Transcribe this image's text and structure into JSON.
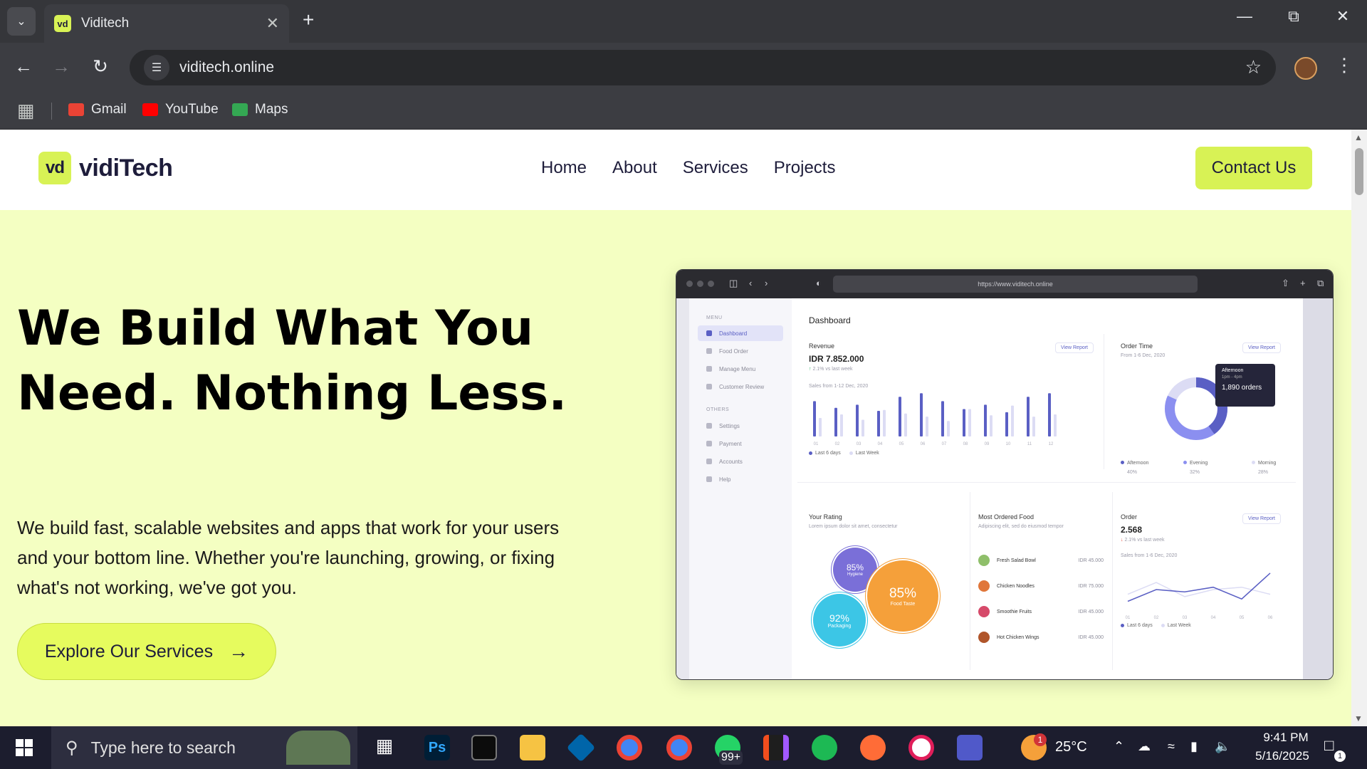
{
  "browser": {
    "tab_list_icon": "chevron-down-icon",
    "tab_title": "Viditech",
    "favicon_text": "vd",
    "url": "viditech.online",
    "bookmarks": [
      {
        "label": "Gmail",
        "color": "#ea4335"
      },
      {
        "label": "YouTube",
        "color": "#ff0000"
      },
      {
        "label": "Maps",
        "color": "#34a853"
      }
    ]
  },
  "site": {
    "logo_mark": "vd",
    "brand": "vidiTech",
    "nav": [
      "Home",
      "About",
      "Services",
      "Projects"
    ],
    "contact_label": "Contact Us",
    "accent": "#d8f255",
    "hero_bg": "#f4ffc2",
    "hero_title": "We Build What You Need. Nothing Less.",
    "hero_desc": "We build fast, scalable websites and apps that work for your users and your bottom line. Whether you're launching, growing, or fixing what's not working, we've got you.",
    "cta_label": "Explore Our Services"
  },
  "mockup": {
    "url": "https://www.viditech.online",
    "menu_heading": "MENU",
    "menu": [
      "Dashboard",
      "Food Order",
      "Manage Menu",
      "Customer Review"
    ],
    "others_heading": "OTHERS",
    "others": [
      "Settings",
      "Payment",
      "Accounts",
      "Help"
    ],
    "title": "Dashboard",
    "revenue": {
      "title": "Revenue",
      "value": "IDR 7.852.000",
      "delta": "2.1% vs last week",
      "subtitle": "Sales from 1-12 Dec, 2020",
      "view": "View Report",
      "legend": [
        "Last 6 days",
        "Last Week"
      ],
      "categories": [
        "01",
        "02",
        "03",
        "04",
        "05",
        "06",
        "07",
        "08",
        "09",
        "10",
        "11",
        "12"
      ],
      "last6": [
        0.8,
        0.65,
        0.72,
        0.58,
        0.9,
        0.98,
        0.8,
        0.62,
        0.72,
        0.55,
        0.9,
        0.98
      ],
      "lastweek": [
        0.42,
        0.5,
        0.38,
        0.6,
        0.52,
        0.45,
        0.35,
        0.62,
        0.48,
        0.7,
        0.45,
        0.5
      ]
    },
    "order_time": {
      "title": "Order Time",
      "subtitle": "From 1-6 Dec, 2020",
      "view": "View Report",
      "tooltip_label": "Afternoon",
      "tooltip_time": "1pm - 4pm",
      "tooltip_value": "1,890 orders",
      "legend": [
        {
          "label": "Afternoon",
          "pct": "40%",
          "value": 40,
          "color": "#5a5fc4"
        },
        {
          "label": "Evening",
          "pct": "32%",
          "value": 32,
          "color": "#8b8ff0"
        },
        {
          "label": "Morning",
          "pct": "28%",
          "value": 28,
          "color": "#dcdcf4"
        }
      ]
    },
    "rating": {
      "title": "Your Rating",
      "subtitle": "Lorem ipsum dolor sit amet, consectetur",
      "bubbles": [
        {
          "pct": "85%",
          "label": "Hygiene",
          "color": "#7a6fd8"
        },
        {
          "pct": "85%",
          "label": "Food Taste",
          "color": "#f5a03a"
        },
        {
          "pct": "92%",
          "label": "Packaging",
          "color": "#3cc6e6"
        }
      ]
    },
    "most_ordered": {
      "title": "Most Ordered Food",
      "subtitle": "Adipiscing elit, sed do eiusmod tempor",
      "items": [
        {
          "name": "Fresh Salad Bowl",
          "price": "IDR 45.000",
          "color": "#8fbf6a"
        },
        {
          "name": "Chicken Noodles",
          "price": "IDR 75.000",
          "color": "#e0763a"
        },
        {
          "name": "Smoothie Fruits",
          "price": "IDR 45.000",
          "color": "#d64a6a"
        },
        {
          "name": "Hot Chicken Wings",
          "price": "IDR 45.000",
          "color": "#b0552a"
        }
      ]
    },
    "order": {
      "title": "Order",
      "value": "2.568",
      "delta": "2.1% vs last week",
      "subtitle": "Sales from 1-6 Dec, 2020",
      "view": "View Report",
      "legend": [
        "Last 6 days",
        "Last Week"
      ],
      "categories": [
        "01",
        "02",
        "03",
        "04",
        "05",
        "06"
      ],
      "last6": [
        0.25,
        0.5,
        0.45,
        0.55,
        0.3,
        0.85
      ],
      "lastweek": [
        0.4,
        0.65,
        0.35,
        0.5,
        0.55,
        0.4
      ]
    }
  },
  "taskbar": {
    "search_placeholder": "Type here to search",
    "weather": "25°C",
    "time": "9:41 PM",
    "date": "5/16/2025",
    "whatsapp_badge": "99+",
    "weather_badge": "1",
    "notif_badge": "1"
  }
}
